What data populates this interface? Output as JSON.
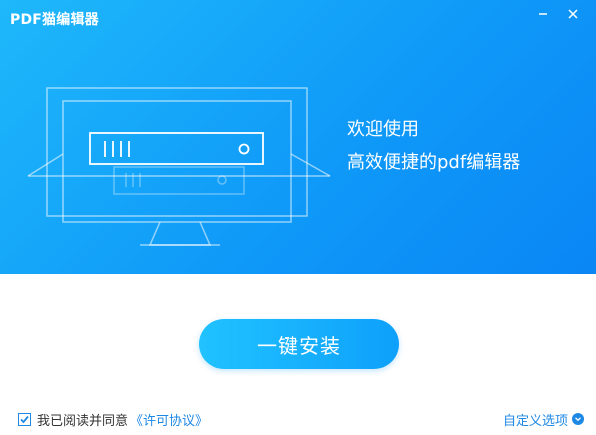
{
  "window": {
    "title": "PDF猫编辑器",
    "minimize_icon": "minimize-icon",
    "close_icon": "close-icon"
  },
  "hero": {
    "welcome": "欢迎使用",
    "tagline": "高效便捷的pdf编辑器",
    "background_color": "#1aa9fa",
    "illustration_icon": "monitor-server-illustration"
  },
  "install": {
    "label": "一键安装",
    "color": "#16b0fd"
  },
  "footer": {
    "agree_checked": true,
    "agree_text": "我已阅读并同意",
    "license_link": "《许可协议》",
    "custom_options": "自定义选项",
    "link_color": "#1e88e5"
  }
}
